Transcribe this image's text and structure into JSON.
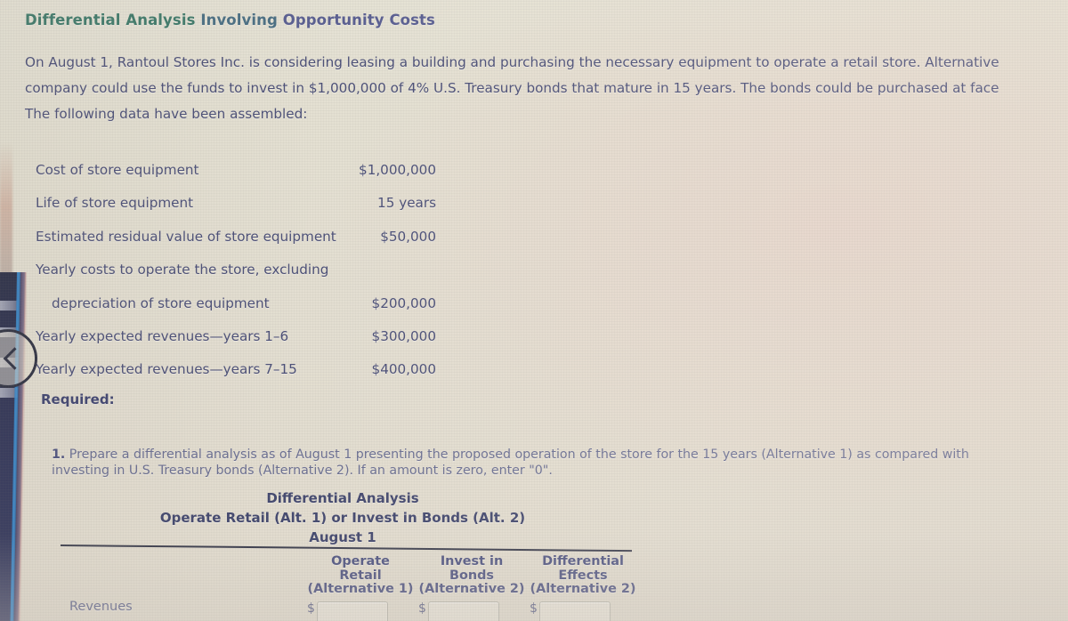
{
  "document": {
    "title": "Differential Analysis Involving Opportunity Costs",
    "title_parts": {
      "part1": "Differential Analysis ",
      "part2": "Involving ",
      "part3": "Opportunity Costs"
    },
    "intro": {
      "line1": "On August 1, Rantoul Stores Inc. is considering leasing a building and purchasing the necessary equipment to operate a retail store. Alternative",
      "line2": "company could use the funds to invest in $1,000,000 of 4% U.S. Treasury bonds that mature in 15 years. The bonds could be purchased at face",
      "line3": "The following data have been assembled:"
    }
  },
  "assembled_data": {
    "rows": [
      {
        "label": "Cost of store equipment",
        "value": "$1,000,000",
        "indent": 0
      },
      {
        "label": "Life of store equipment",
        "value": "15 years",
        "indent": 0
      },
      {
        "label": "Estimated residual value of store equipment",
        "value": "$50,000",
        "indent": 0
      },
      {
        "label": "Yearly costs to operate the store, excluding",
        "value": "",
        "indent": 0
      },
      {
        "label": "depreciation of store equipment",
        "value": "$200,000",
        "indent": 1
      },
      {
        "label": "Yearly expected revenues—years 1–6",
        "value": "$300,000",
        "indent": 0
      },
      {
        "label": "Yearly expected revenues—years 7–15",
        "value": "$400,000",
        "indent": 0
      }
    ]
  },
  "required": {
    "heading": "Required:",
    "item_number": "1.",
    "line1": "Prepare a differential analysis as of August 1 presenting the proposed operation of the store for the 15 years (Alternative 1) as compared with",
    "line2": "investing in U.S. Treasury bonds (Alternative 2). If an amount is zero, enter \"0\"."
  },
  "analysis_table": {
    "heading_line1": "Differential Analysis",
    "heading_line2": "Operate Retail (Alt. 1) or Invest in Bonds (Alt. 2)",
    "heading_line3": "August 1",
    "columns": [
      {
        "line1": "Operate",
        "line2": "Retail",
        "line3": "(Alternative 1)"
      },
      {
        "line1": "Invest in",
        "line2": "Bonds",
        "line3": "(Alternative 2)"
      },
      {
        "line1": "Differential",
        "line2": "Effects",
        "line3": "(Alternative 2)"
      }
    ],
    "rows": [
      {
        "label": "Revenues",
        "cells": [
          {
            "prefix": "$",
            "value": ""
          },
          {
            "prefix": "$",
            "value": ""
          },
          {
            "prefix": "$",
            "value": ""
          }
        ]
      }
    ]
  },
  "navigation": {
    "back_label": "‹"
  },
  "colors": {
    "title_green": "#3e7a6a",
    "body_text": "#4b4f77",
    "heading_text": "#44496f",
    "muted_text": "#6b6f92",
    "rule": "#3a3c4c",
    "chrome_dark": "#2c3050",
    "chrome_accent": "#3f93d6",
    "screen_bg": "#e4e0d2"
  }
}
